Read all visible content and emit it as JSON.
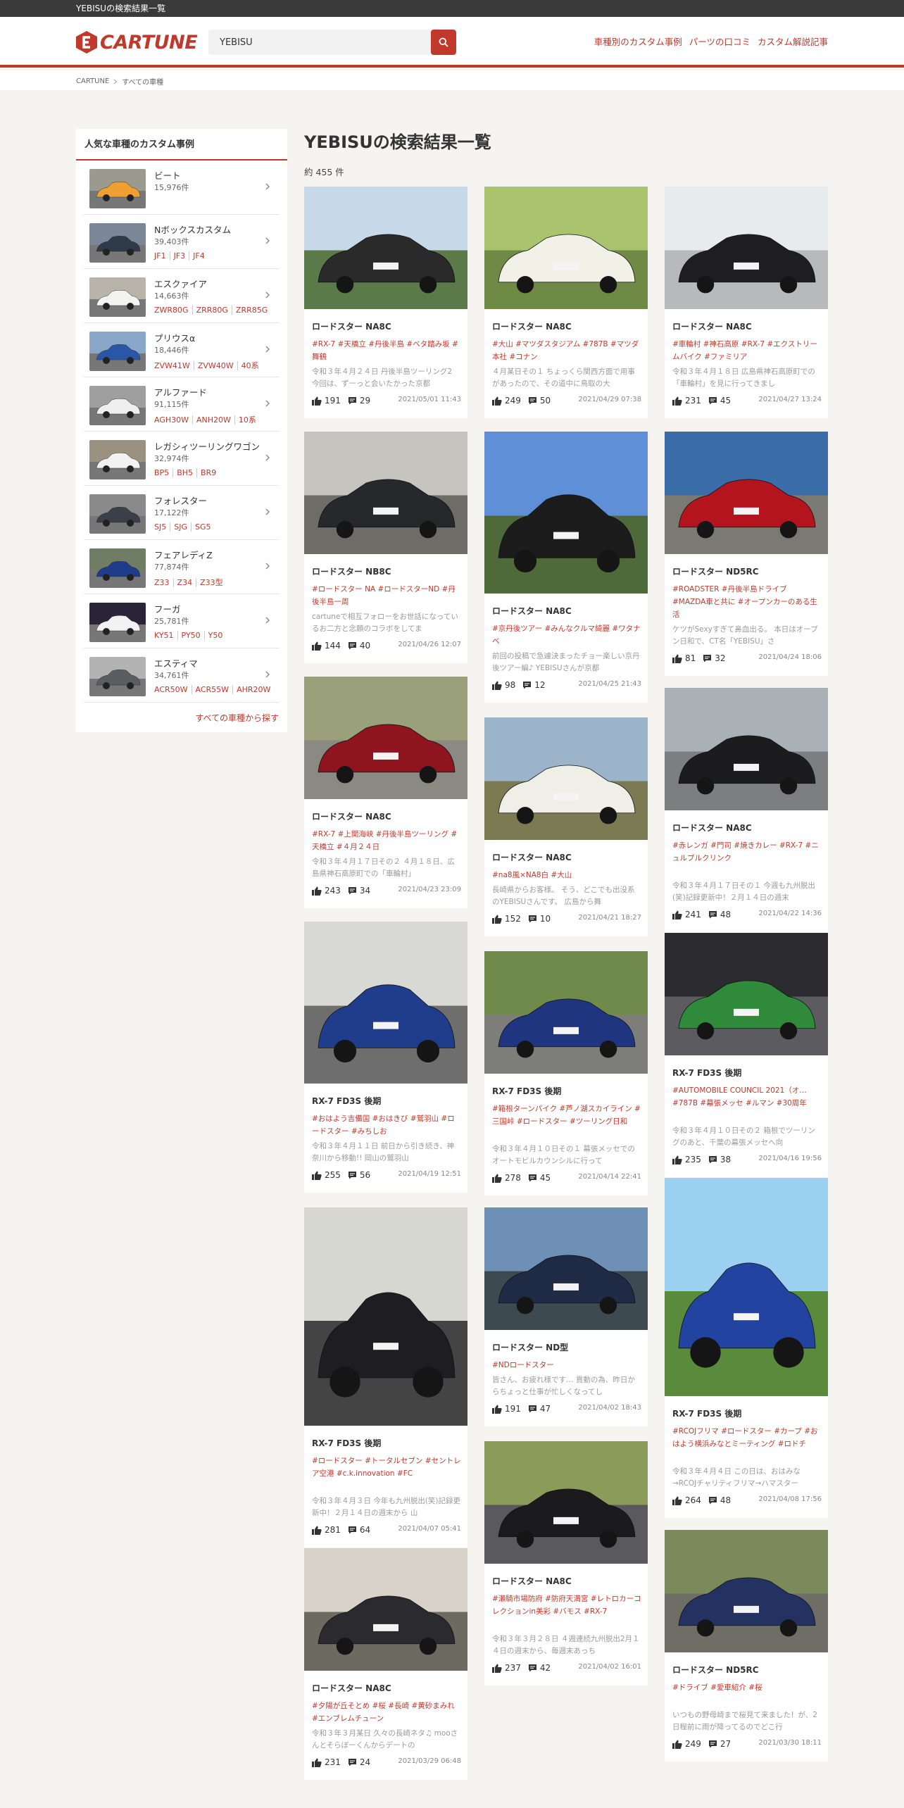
{
  "topbar": {
    "title": "YEBISUの検索結果一覧"
  },
  "header": {
    "logo_text": "CARTUNE",
    "search": {
      "value": "YEBISU",
      "placeholder": ""
    },
    "nav": [
      "車種別のカスタム事例",
      "パーツの口コミ",
      "カスタム解説記事"
    ]
  },
  "breadcrumb": [
    "CARTUNE",
    "すべての車種"
  ],
  "sidebar": {
    "title": "人気な車種のカスタム事例",
    "more": "すべての車種から探す",
    "items": [
      {
        "name": "ビート",
        "count": "15,976件",
        "models": []
      },
      {
        "name": "Nボックスカスタム",
        "count": "39,403件",
        "models": [
          "JF1",
          "JF3",
          "JF4"
        ]
      },
      {
        "name": "エスクァイア",
        "count": "14,663件",
        "models": [
          "ZWR80G",
          "ZRR80G",
          "ZRR85G"
        ]
      },
      {
        "name": "プリウスα",
        "count": "18,446件",
        "models": [
          "ZVW41W",
          "ZVW40W",
          "40系"
        ]
      },
      {
        "name": "アルファード",
        "count": "91,115件",
        "models": [
          "AGH30W",
          "ANH20W",
          "10系"
        ]
      },
      {
        "name": "レガシィツーリングワゴン",
        "count": "32,974件",
        "models": [
          "BP5",
          "BH5",
          "BR9"
        ]
      },
      {
        "name": "フォレスター",
        "count": "17,122件",
        "models": [
          "SJ5",
          "SJG",
          "SG5"
        ]
      },
      {
        "name": "フェアレディZ",
        "count": "77,874件",
        "models": [
          "Z33",
          "Z34",
          "Z33型"
        ]
      },
      {
        "name": "フーガ",
        "count": "25,781件",
        "models": [
          "KY51",
          "PY50",
          "Y50"
        ]
      },
      {
        "name": "エスティマ",
        "count": "34,761件",
        "models": [
          "ACR50W",
          "ACR55W",
          "AHR20W"
        ]
      }
    ]
  },
  "main": {
    "title": "YEBISUの検索結果一覧",
    "count": "約 455 件",
    "cards": [
      {
        "title": "ロードスター NA8C",
        "tags": "#RX-7 #天橋立 #丹後半島 #ベタ踏み坂 #舞鶴",
        "text": "令和３年４月２４日 丹後半島ツーリング2 今回は、ずーっと会いたかった京都",
        "likes": "191",
        "comments": "29",
        "date": "2021/05/01 11:43"
      },
      {
        "title": "ロードスター NA8C",
        "tags": "#大山 #マツダスタジアム #787B #マツダ本社 #コナン",
        "text": "４月某日その１ ちょっくら関西方面で用事があったので、その道中に鳥取の大",
        "likes": "249",
        "comments": "50",
        "date": "2021/04/29 07:38"
      },
      {
        "title": "ロードスター NA8C",
        "tags": "#車輪村 #神石高原 #RX-7 #エクストリームバイク #ファミリア",
        "text": "令和３年４月１８日 広島県神石高原町での「車輪村」を見に行ってきまし",
        "likes": "231",
        "comments": "45",
        "date": "2021/04/27 13:24"
      },
      {
        "title": "ロードスター NB8C",
        "tags": "#ロードスター NA #ロードスターND #丹後半島一周",
        "text": "cartuneで相互フォローをお世話になっているお二方と念願のコラボをしてま",
        "likes": "144",
        "comments": "40",
        "date": "2021/04/26 12:07"
      },
      {
        "title": "ロードスター NA8C",
        "tags": "#京丹後ツアー #みんなクルマ綺麗 #ワタナベ",
        "text": "前回の投稿で急遽決まったチョー楽しい京丹後ツアー編♪ YEBISUさんが京都",
        "likes": "98",
        "comments": "12",
        "date": "2021/04/25 21:43"
      },
      {
        "title": "ロードスター ND5RC",
        "tags": "#ROADSTER #丹後半島ドライブ #MAZDA車と共に #オープンカーのある生活",
        "text": "ケツがSexyすぎて鼻血出る。 本日はオープン日和で、CT名「YEBISU」さ",
        "likes": "81",
        "comments": "32",
        "date": "2021/04/24 18:06"
      },
      {
        "title": "ロードスター NA8C",
        "tags": "#RX-7 #上関海峡 #丹後半島ツーリング #天橋立 #４月２４日",
        "text": "令和３年４月１７日その２ ４月１８日、広島県神石高原町での「車輪村」",
        "likes": "243",
        "comments": "34",
        "date": "2021/04/23 23:09"
      },
      {
        "title": "ロードスター NA8C",
        "tags": "#na8風×NA8白 #大山",
        "text": "長崎県からお客様。 そう、どこでも出没系のYEBISUさんです。 広島から舞",
        "likes": "152",
        "comments": "10",
        "date": "2021/04/21 18:27"
      },
      {
        "title": "ロードスター NA8C",
        "tags": "#赤レンガ #門司 #焼きカレー #RX-7 #ニュルブルクリンク",
        "text": "令和３年４月１７日その１ 今週も九州脱出(笑)記録更新中！２月１４日の週末",
        "likes": "241",
        "comments": "48",
        "date": "2021/04/22 14:36"
      },
      {
        "title": "RX-7 FD3S 後期",
        "tags": "#おはよう吉備国 #おはきび #鷲羽山 #ロードスター #みちしお",
        "text": "令和３年４月１１日 前日から引き続き、神奈川から移動!! 岡山の鷲羽山",
        "likes": "255",
        "comments": "56",
        "date": "2021/04/19 12:51"
      },
      {
        "title": "RX-7 FD3S 後期",
        "tags": "#箱根ターンパイク #芦ノ湖スカイライン #三国峠 #ロードスター #ツーリング日和",
        "text": "令和３年４月１０日その１ 幕張メッセでのオートモビルカウンシルに行って",
        "likes": "278",
        "comments": "45",
        "date": "2021/04/14 22:41"
      },
      {
        "title": "RX-7 FD3S 後期",
        "tags": "#AUTOMOBILE COUNCIL 2021（オ… #787B #幕張メッセ #ルマン #30周年",
        "text": "令和３年４月１０日その２ 箱根でツーリングのあと、千葉の幕張メッセへ向",
        "likes": "235",
        "comments": "38",
        "date": "2021/04/16 19:56"
      },
      {
        "title": "RX-7 FD3S 後期",
        "tags": "#ロードスター #トータルセブン #セントレア空港 #c.k.innovation #FC",
        "text": "令和３年４月３日 今年も九州脱出(笑)記録更新中！２月１４日の週末から 山",
        "likes": "281",
        "comments": "64",
        "date": "2021/04/07 05:41"
      },
      {
        "title": "ロードスター ND型",
        "tags": "#NDロードスター",
        "text": "皆さん、お疲れ様です… 貫動の為、昨日からちょっと仕事が忙しくなってし",
        "likes": "191",
        "comments": "47",
        "date": "2021/04/02 18:43"
      },
      {
        "title": "RX-7 FD3S 後期",
        "tags": "#RCOJフリマ #ロードスター #カープ #おはよう横浜みなとミーティング #ロドチ",
        "text": "令和３年４月４日 この日は、おはみな→RCOJチャリティフリマ→ハマスター",
        "likes": "264",
        "comments": "48",
        "date": "2021/04/08 17:56"
      },
      {
        "title": "ロードスター NA8C",
        "tags": "#夕陽が丘そとめ #桜 #長崎 #黄砂まみれ #エンブレムチューン",
        "text": "令和３年３月某日 久々の長崎ネタ♫ mooさんとそらぼーくんからデートの",
        "likes": "231",
        "comments": "24",
        "date": "2021/03/29 06:48"
      },
      {
        "title": "ロードスター NA8C",
        "tags": "#瀬騎市場防府 #防府天満宮 #レトロカーコレクションin美彩 #バモス #RX-7",
        "text": "令和３年３月２８日 ４週連続九州脱出2月１４日の週末から、毎週末あっち",
        "likes": "237",
        "comments": "42",
        "date": "2021/04/02 16:01"
      },
      {
        "title": "ロードスター ND5RC",
        "tags": "#ドライブ #愛車紹介 #桜",
        "text": "いつもの野母崎まで桜見て来ました！が、2日程前に雨が降ってるのでどこ行",
        "likes": "249",
        "comments": "27",
        "date": "2021/03/30 18:11"
      }
    ]
  },
  "colors": {
    "accent": "#c0392b",
    "topbar": "#3a3a3a",
    "background": "#f5f4f1"
  }
}
